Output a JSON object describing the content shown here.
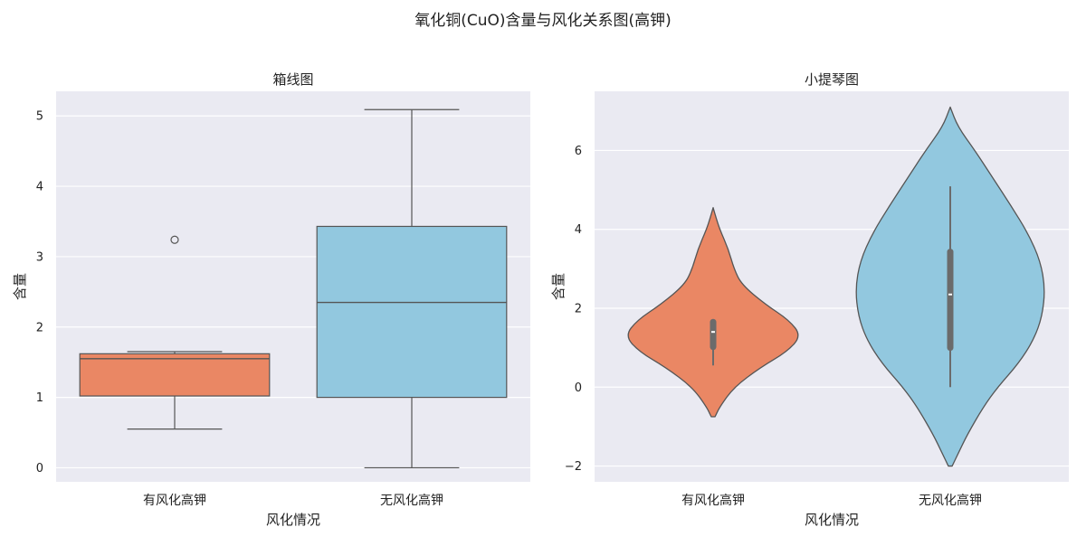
{
  "suptitle": "氧化铜(CuO)含量与风化关系图(高钾)",
  "colors": {
    "plot_bg": "#eaeaf2",
    "grid": "#ffffff",
    "weathered": "#ea8764",
    "unweathered": "#92c8df",
    "edge": "#555555",
    "inner": "#6b6b6b"
  },
  "chart_data": [
    {
      "type": "box",
      "title": "箱线图",
      "xlabel": "风化情况",
      "ylabel": "含量",
      "categories": [
        "有风化高钾",
        "无风化高钾"
      ],
      "yticks": [
        0,
        1,
        2,
        3,
        4,
        5
      ],
      "ylim": [
        -0.2,
        5.35
      ],
      "grid": true,
      "boxes": [
        {
          "category": "有风化高钾",
          "whisker_low": 0.55,
          "q1": 1.02,
          "median": 1.55,
          "q3": 1.62,
          "whisker_high": 1.65,
          "outliers": [
            3.24
          ]
        },
        {
          "category": "无风化高钾",
          "whisker_low": 0.0,
          "q1": 1.0,
          "median": 2.35,
          "q3": 3.43,
          "whisker_high": 5.09,
          "outliers": []
        }
      ]
    },
    {
      "type": "violin",
      "title": "小提琴图",
      "xlabel": "风化情况",
      "ylabel": "含量",
      "categories": [
        "有风化高钾",
        "无风化高钾"
      ],
      "yticks": [
        -2,
        0,
        2,
        4,
        6
      ],
      "ytick_labels": [
        "−2",
        "0",
        "2",
        "4",
        "6"
      ],
      "ylim": [
        -2.4,
        7.5
      ],
      "grid": true,
      "violins": [
        {
          "category": "有风化高钾",
          "density_y": [
            -0.75,
            -0.5,
            0.0,
            0.5,
            0.9,
            1.3,
            1.7,
            2.1,
            2.6,
            3.0,
            3.5,
            4.0,
            4.3,
            4.55
          ],
          "density_w": [
            0.02,
            0.07,
            0.22,
            0.5,
            0.78,
            0.93,
            0.8,
            0.55,
            0.3,
            0.22,
            0.16,
            0.07,
            0.03,
            0.0
          ],
          "whisker_low": 0.55,
          "q1": 1.02,
          "median": 1.4,
          "q3": 1.65,
          "whisker_high": 1.65
        },
        {
          "category": "无风化高钾",
          "density_y": [
            -2.0,
            -1.7,
            -1.2,
            -0.5,
            0.0,
            0.6,
            1.2,
            1.8,
            2.5,
            3.2,
            3.9,
            4.6,
            5.3,
            6.0,
            6.6,
            7.1
          ],
          "density_w": [
            0.02,
            0.08,
            0.18,
            0.35,
            0.5,
            0.72,
            0.88,
            0.97,
            1.0,
            0.95,
            0.82,
            0.64,
            0.45,
            0.26,
            0.08,
            0.0
          ],
          "whisker_low": 0.0,
          "q1": 1.0,
          "median": 2.35,
          "q3": 3.43,
          "whisker_high": 5.09
        }
      ]
    }
  ]
}
